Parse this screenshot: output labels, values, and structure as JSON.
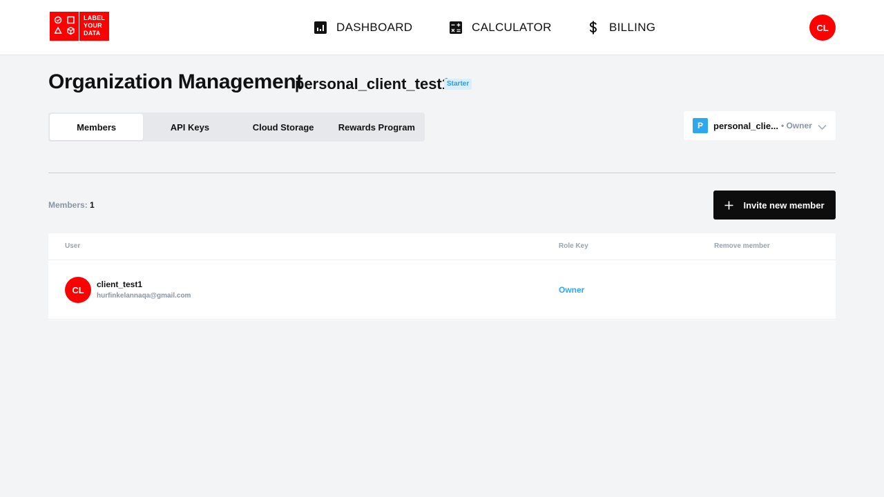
{
  "header": {
    "logo": {
      "lines": [
        "LABEL",
        "YOUR",
        "DATA"
      ],
      "color": "#ff0000"
    },
    "nav": [
      {
        "label": "DASHBOARD",
        "icon": "bar-chart-icon"
      },
      {
        "label": "CALCULATOR",
        "icon": "calculator-icon"
      },
      {
        "label": "BILLING",
        "icon": "dollar-icon"
      }
    ],
    "user_initials": "CL"
  },
  "page": {
    "title": "Organization Management",
    "org_name": "personal_client_test1",
    "plan_badge": "Starter"
  },
  "tabs": [
    {
      "label": "Members",
      "active": true
    },
    {
      "label": "API Keys",
      "active": false
    },
    {
      "label": "Cloud Storage",
      "active": false
    },
    {
      "label": "Rewards Program",
      "active": false
    }
  ],
  "org_selector": {
    "initial": "P",
    "name": "personal_clie...",
    "role": "• Owner"
  },
  "members": {
    "count_label": "Members:",
    "count": "1",
    "invite_label": "Invite new member"
  },
  "table": {
    "columns": [
      "User",
      "Role Key",
      "Remove member"
    ],
    "rows": [
      {
        "initials": "CL",
        "name": "client_test1",
        "email": "hurfinkelannaqa@gmail.com",
        "role": "Owner"
      }
    ]
  },
  "colors": {
    "brand": "#ff0000",
    "accent": "#2ea7f0",
    "button": "#0d0d0d"
  }
}
